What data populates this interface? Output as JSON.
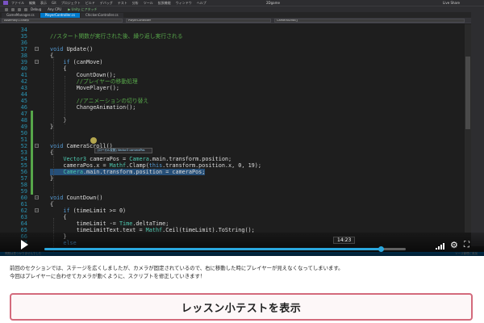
{
  "ide": {
    "menu": [
      "ファイル",
      "編集",
      "表示",
      "Git",
      "プロジェクト",
      "ビルド",
      "デバッグ",
      "テスト",
      "分析",
      "ツール",
      "拡張機能",
      "ウィンドウ",
      "ヘルプ"
    ],
    "window_title": "2Dgame",
    "liveshare": "Live Share",
    "toolbar": {
      "config": "Debug",
      "platform": "Any CPU",
      "run": "▶ Unity にアタッチ"
    },
    "tabs": [
      {
        "label": "GameManager.cs"
      },
      {
        "label": "PlayerController.cs",
        "active": true
      },
      {
        "label": "ChickenController.cs"
      }
    ],
    "nav": {
      "left": "Assembly-CSharp",
      "middle": "PlayerController",
      "right": "CameraScroll()"
    },
    "accent": "#007acc"
  },
  "editor": {
    "line_numbers": [
      "34",
      "35",
      "36",
      "37",
      "38",
      "39",
      "40",
      "41",
      "42",
      "43",
      "44",
      "45",
      "46",
      "47",
      "48",
      "49",
      "50",
      "51",
      "52",
      "53",
      "54",
      "55",
      "56",
      "57",
      "58",
      "59",
      "60",
      "61",
      "62",
      "63",
      "64",
      "65"
    ],
    "lines": [
      "",
      "//スタート関数が実行された後、繰り返し実行される",
      "",
      "void Update()",
      "{",
      "    if (canMove)",
      "    {",
      "        CountDown();",
      "        //プレイヤーの移動処理",
      "        MovePlayer();",
      "",
      "        //アニメーションの切り替え",
      "        ChangeAnimation();",
      "",
      "    }",
      "}",
      "",
      "",
      "void CameraScroll()",
      "{",
      "    Vector3 cameraPos = Camera.main.transform.position;",
      "    cameraPos.x = Mathf.Clamp(this.transform.position.x, 0, 19);",
      "    Camera.main.transform.position = cameraPos;",
      "}",
      "",
      "",
      "void CountDown()",
      "{",
      "    if (timeLimit >= 0)",
      "    {",
      "        timeLimit -= Time.deltaTime;",
      "        timeLimitText.text = Mathf.Ceil(timeLimit).ToString();"
    ],
    "more_lines": [
      "    }",
      "    else"
    ],
    "more_numbers": [
      "66",
      "67"
    ],
    "tooltip": "(ローカル変数) Vector3 cameraPos"
  },
  "player": {
    "time": "14:23",
    "progress": 0.93
  },
  "statusbar": {
    "left": "問題は見つかりませんでした",
    "right": "ソース管理に追加"
  },
  "description": {
    "line1": "前回のセクションでは、ステージを広くしましたが、カメラが固定されているので、右に移動した時にプレイヤーが見えなくなってしまいます。",
    "line2": "今回はプレイヤーに合わせてカメラが動くように、スクリプトを修正していきます！"
  },
  "cta": {
    "label": "レッスン小テストを表示",
    "border_color": "#d36a7c"
  }
}
